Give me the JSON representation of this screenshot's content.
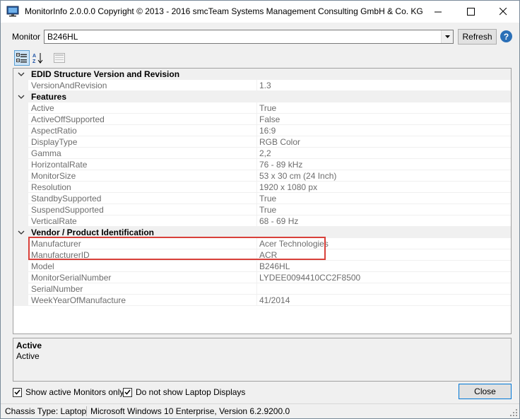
{
  "window": {
    "title": "MonitorInfo 2.0.0.0 Copyright © 2013 - 2016 smcTeam Systems Management Consulting GmbH & Co. KG",
    "icon": "monitor-icon",
    "controls": [
      "minimize-icon",
      "maximize-icon",
      "close-icon"
    ]
  },
  "monitor_selector": {
    "label": "Monitor",
    "selected": "B246HL",
    "refresh_label": "Refresh",
    "help_glyph": "?"
  },
  "toolbar": {
    "icons": [
      "categorized-icon",
      "alphabetical-sort-icon",
      "property-pages-icon"
    ],
    "categorized_active": true
  },
  "property_grid": {
    "categories": [
      {
        "name": "EDID Structure Version and Revision",
        "expanded": true,
        "properties": [
          {
            "name": "VersionAndRevision",
            "value": "1.3"
          }
        ]
      },
      {
        "name": "Features",
        "expanded": true,
        "properties": [
          {
            "name": "Active",
            "value": "True"
          },
          {
            "name": "ActiveOffSupported",
            "value": "False"
          },
          {
            "name": "AspectRatio",
            "value": "16:9"
          },
          {
            "name": "DisplayType",
            "value": "RGB Color"
          },
          {
            "name": "Gamma",
            "value": "2,2"
          },
          {
            "name": "HorizontalRate",
            "value": "76 - 89 kHz"
          },
          {
            "name": "MonitorSize",
            "value": "53 x 30 cm (24 Inch)"
          },
          {
            "name": "Resolution",
            "value": "1920 x 1080 px"
          },
          {
            "name": "StandbySupported",
            "value": "True"
          },
          {
            "name": "SuspendSupported",
            "value": "True"
          },
          {
            "name": "VerticalRate",
            "value": "68 - 69 Hz"
          }
        ]
      },
      {
        "name": "Vendor / Product Identification",
        "expanded": true,
        "properties": [
          {
            "name": "Manufacturer",
            "value": "Acer Technologies"
          },
          {
            "name": "ManufacturerID",
            "value": "ACR"
          },
          {
            "name": "Model",
            "value": "B246HL"
          },
          {
            "name": "MonitorSerialNumber",
            "value": "LYDEE0094410CC2F8500"
          },
          {
            "name": "SerialNumber",
            "value": ""
          },
          {
            "name": "WeekYearOfManufacture",
            "value": "41/2014"
          }
        ]
      }
    ],
    "highlight_color": "#d9403a"
  },
  "description": {
    "title": "Active",
    "text": "Active"
  },
  "options": {
    "show_active_label": "Show active Monitors only",
    "show_active_checked": true,
    "no_laptop_label": "Do not show Laptop Displays",
    "no_laptop_checked": true,
    "close_label": "Close"
  },
  "statusbar": {
    "chassis": "Chassis Type: Laptop",
    "os": "Microsoft Windows 10 Enterprise, Version 6.2.9200.0"
  }
}
